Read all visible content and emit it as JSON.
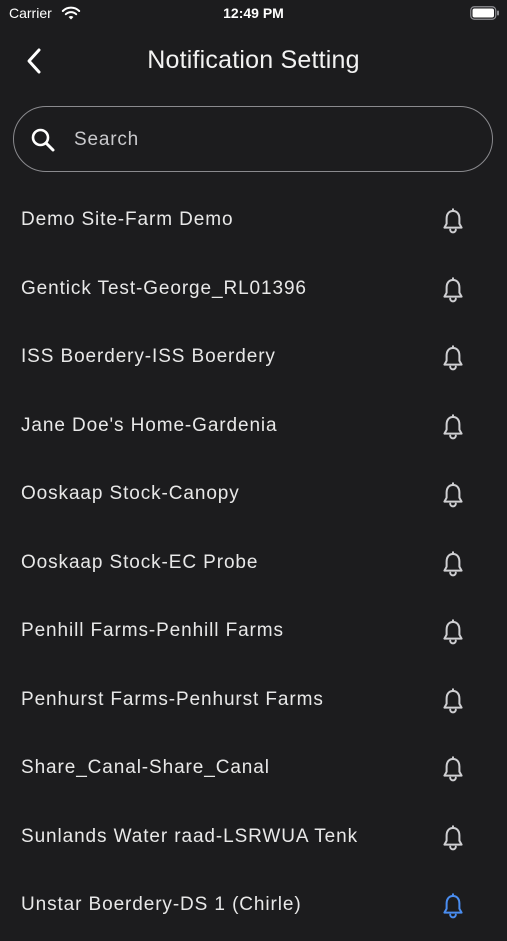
{
  "status_bar": {
    "carrier": "Carrier",
    "time": "12:49 PM"
  },
  "nav": {
    "title": "Notification Setting"
  },
  "search": {
    "placeholder": "Search",
    "value": ""
  },
  "sites": [
    {
      "label": "Demo Site-Farm Demo",
      "notifications": "off"
    },
    {
      "label": "Gentick Test-George_RL01396",
      "notifications": "off"
    },
    {
      "label": "ISS Boerdery-ISS Boerdery",
      "notifications": "off"
    },
    {
      "label": "Jane Doe's Home-Gardenia",
      "notifications": "off"
    },
    {
      "label": "Ooskaap Stock-Canopy",
      "notifications": "off"
    },
    {
      "label": "Ooskaap Stock-EC Probe",
      "notifications": "off"
    },
    {
      "label": "Penhill Farms-Penhill Farms",
      "notifications": "off"
    },
    {
      "label": "Penhurst Farms-Penhurst Farms",
      "notifications": "off"
    },
    {
      "label": "Share_Canal-Share_Canal",
      "notifications": "off"
    },
    {
      "label": "Sunlands Water raad-LSRWUA Tenk",
      "notifications": "off"
    },
    {
      "label": "Unstar Boerdery-DS 1 (Chirle)",
      "notifications": "on"
    }
  ],
  "colors": {
    "background": "#1c1c1e",
    "text": "#e8e8e8",
    "icon": "#cfcfd2",
    "accent": "#4a8df0"
  },
  "icons": {
    "back": "chevron-left-icon",
    "search": "magnifier-icon",
    "bell": "bell-icon"
  }
}
